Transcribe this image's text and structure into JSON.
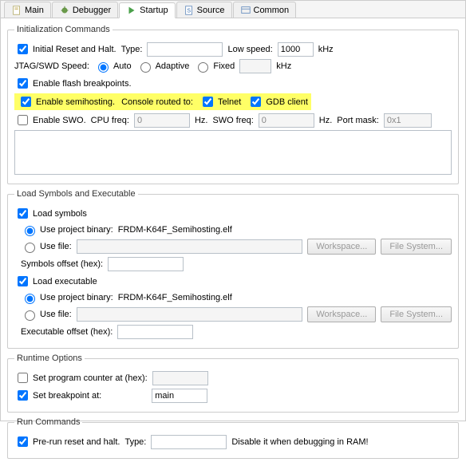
{
  "tabs": {
    "main": "Main",
    "debugger": "Debugger",
    "startup": "Startup",
    "source": "Source",
    "common": "Common"
  },
  "init": {
    "legend": "Initialization Commands",
    "initial_reset": "Initial Reset and Halt.",
    "type_label": "Type:",
    "type_value": "",
    "low_speed_label": "Low speed:",
    "low_speed_value": "1000",
    "low_speed_unit": "kHz",
    "jtag_label": "JTAG/SWD Speed:",
    "speed_auto": "Auto",
    "speed_adaptive": "Adaptive",
    "speed_fixed": "Fixed",
    "fixed_value": "",
    "fixed_unit": "kHz",
    "flash_bp": "Enable flash breakpoints.",
    "semihosting": "Enable semihosting.",
    "console_label": "Console routed to:",
    "telnet": "Telnet",
    "gdb": "GDB client",
    "swo": "Enable SWO.",
    "cpu_freq_label": "CPU freq:",
    "cpu_freq_value": "0",
    "hz1": "Hz.",
    "swo_freq_label": "SWO freq:",
    "swo_freq_value": "0",
    "hz2": "Hz.",
    "port_mask_label": "Port mask:",
    "port_mask_value": "0x1"
  },
  "load": {
    "legend": "Load Symbols and Executable",
    "load_symbols": "Load symbols",
    "use_project_binary": "Use project binary:",
    "binary_name": "FRDM-K64F_Semihosting.elf",
    "use_file": "Use file:",
    "workspace_btn": "Workspace...",
    "filesystem_btn": "File System...",
    "symbols_offset_label": "Symbols offset (hex):",
    "symbols_offset_value": "",
    "load_exec": "Load executable",
    "exec_offset_label": "Executable offset (hex):",
    "exec_offset_value": ""
  },
  "runtime": {
    "legend": "Runtime Options",
    "set_pc": "Set program counter at (hex):",
    "pc_value": "",
    "set_bp": "Set breakpoint at:",
    "bp_value": "main"
  },
  "run": {
    "legend": "Run Commands",
    "pre_run": "Pre-run reset and halt.",
    "type_label": "Type:",
    "type_value": "",
    "hint": "Disable it when debugging in RAM!"
  }
}
